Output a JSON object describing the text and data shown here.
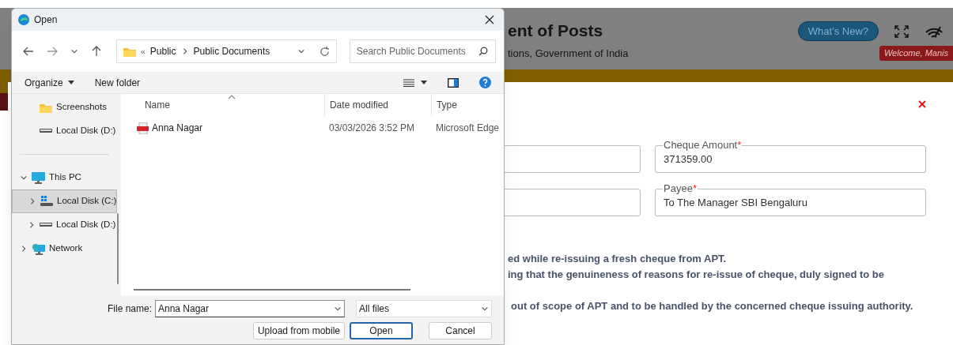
{
  "page": {
    "title": "ent of Posts",
    "subtitle": "tions, Government of India",
    "whats_new": "What’s New?",
    "welcome": "Welcome, Manis"
  },
  "form": {
    "fields": [
      {
        "label": "Cheque Amount",
        "required_mark": "*",
        "value": "371359.00"
      },
      {
        "label": "Payee",
        "required_mark": "*",
        "value": "To The Manager SBI Bengaluru"
      }
    ],
    "notes": [
      "ed while re-issuing a fresh cheque from APT.",
      "ing that the genuineness of reasons for re-issue of cheque, duly signed to be",
      "out of scope of APT and to be handled by the concerned cheque issuing authority."
    ]
  },
  "dialog": {
    "title": "Open",
    "breadcrumb_overflow": "«",
    "breadcrumb": [
      "Public",
      "Public Documents"
    ],
    "search": {
      "placeholder": "Search Public Documents"
    },
    "toolbar": [
      "Organize",
      "New folder"
    ],
    "sidebar": [
      {
        "kind": "item",
        "label": "Screenshots",
        "selected": false
      },
      {
        "kind": "item",
        "label": "Local Disk (D:)",
        "selected": false
      },
      {
        "kind": "divider"
      },
      {
        "kind": "node",
        "label": "This PC",
        "selected": false,
        "expanded": true,
        "children": [
          {
            "kind": "node",
            "label": "Local Disk (C:)",
            "selected": true,
            "expanded": false
          },
          {
            "kind": "node",
            "label": "Local Disk (D:)",
            "selected": false,
            "expanded": false
          }
        ]
      },
      {
        "kind": "node",
        "label": "Network",
        "selected": false,
        "expanded": false
      }
    ],
    "columns": [
      "Name",
      "Date modified",
      "Type"
    ],
    "rows": [
      {
        "name": "Anna Nagar",
        "date": "03/03/2026 3:52 PM",
        "type": "Microsoft Edge"
      }
    ],
    "file_name_label": "File name:",
    "file_name": "Anna Nagar",
    "filter": "All files",
    "buttons": [
      "Upload from mobile",
      "Open",
      "Cancel"
    ]
  }
}
